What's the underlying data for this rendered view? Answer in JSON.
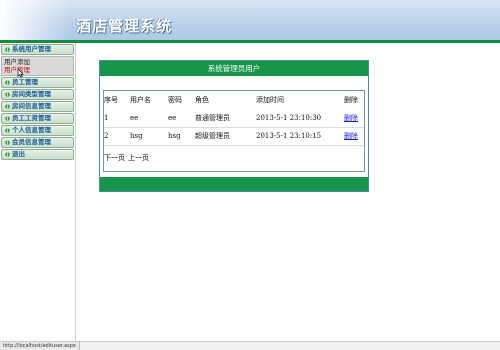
{
  "header": {
    "title": "酒店管理系统"
  },
  "sidebar": {
    "items": [
      {
        "label": "系统用户管理"
      },
      {
        "label": "员工管理"
      },
      {
        "label": "房间类型管理"
      },
      {
        "label": "房间信息管理"
      },
      {
        "label": "员工工资管理"
      },
      {
        "label": "个人信息管理"
      },
      {
        "label": "会员信息管理"
      },
      {
        "label": "退出"
      }
    ],
    "submenu": [
      {
        "label": "用户添加"
      },
      {
        "label": "用户管理"
      }
    ]
  },
  "panel": {
    "title": "系统管理员用户",
    "columns": [
      "序号",
      "用户名",
      "密码",
      "角色",
      "添加时间",
      "删除"
    ],
    "rows": [
      {
        "id": "1",
        "username": "ee",
        "password": "ee",
        "role": "普通管理员",
        "time": "2013-5-1 23:10:30",
        "action": "删除"
      },
      {
        "id": "2",
        "username": "hsg",
        "password": "hsg",
        "role": "超级管理员",
        "time": "2013-5-1 23:10:15",
        "action": "删除"
      }
    ],
    "pager": {
      "next": "下一页",
      "prev": "上一页"
    }
  },
  "status": {
    "url": "http://localhost/edituser.aspx"
  },
  "colors": {
    "accent_green": "#17954a",
    "link_blue": "#1a1ad0",
    "header_blue": "#bcd2ea"
  }
}
